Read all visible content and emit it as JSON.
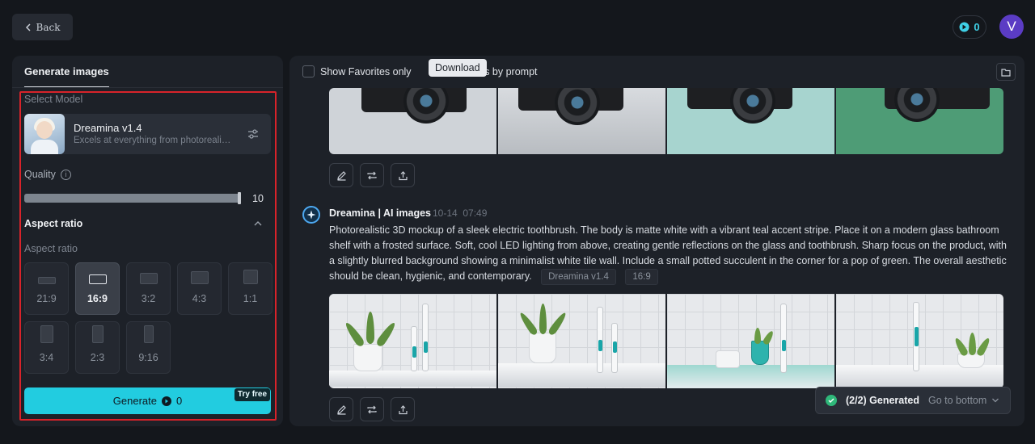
{
  "header": {
    "back_label": "Back",
    "credits": "0",
    "avatar_letter": "V"
  },
  "left": {
    "tab_label": "Generate images",
    "select_model_label": "Select Model",
    "model": {
      "name": "Dreamina v1.4",
      "description": "Excels at everything from photorealism"
    },
    "quality_label": "Quality",
    "quality_value": "10",
    "quality_fraction": 1.0,
    "aspect_ratio_header": "Aspect ratio",
    "aspect_ratio_sub": "Aspect ratio",
    "aspect_ratios": [
      "21:9",
      "16:9",
      "3:2",
      "4:3",
      "1:1",
      "3:4",
      "2:3",
      "9:16"
    ],
    "selected_ratio": "16:9",
    "generate_label": "Generate",
    "generate_cost": "0",
    "try_free_label": "Try free"
  },
  "right": {
    "favorites_label": "Show Favorites only",
    "partial_label": "ults by prompt",
    "tooltip": "Download",
    "result": {
      "author": "Dreamina | AI images",
      "date": "10-14",
      "time": "07:49",
      "prompt": "Photorealistic 3D mockup of a sleek electric toothbrush. The body is matte white with a vibrant teal accent stripe. Place it on a modern glass bathroom shelf with a frosted surface. Soft, cool LED lighting from above, creating gentle reflections on the glass and toothbrush. Sharp focus on the product, with a slightly blurred background showing a minimalist white tile wall. Include a small potted succulent in the corner for a pop of green. The overall aesthetic should be clean, hygienic, and contemporary.",
      "model_tag": "Dreamina v1.4",
      "ratio_tag": "16:9"
    },
    "toast": {
      "status": "(2/2) Generated",
      "link": "Go to bottom"
    }
  },
  "colors": {
    "accent": "#22cce0",
    "highlight_border": "#d8232a",
    "success": "#2fb87a"
  }
}
